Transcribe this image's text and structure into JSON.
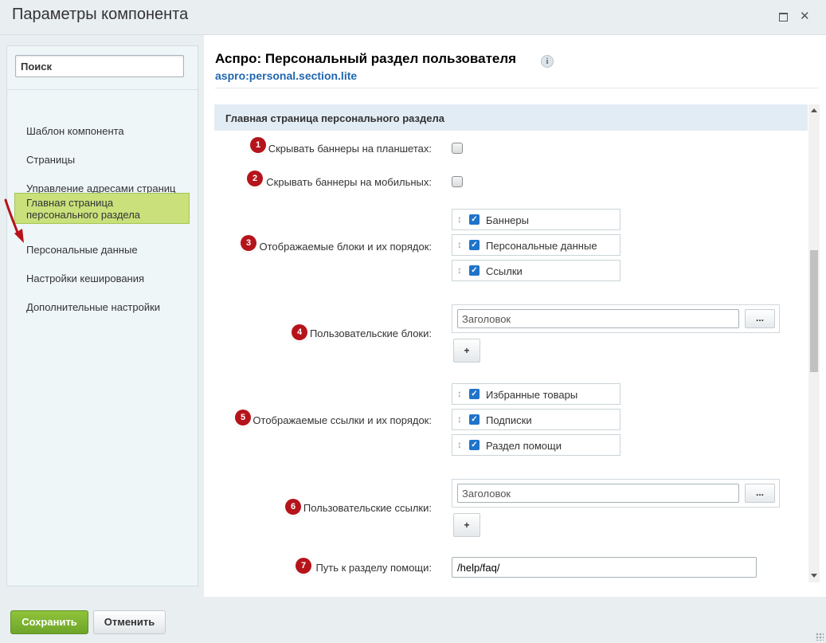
{
  "dialog": {
    "title": "Параметры компонента"
  },
  "sidebar": {
    "search_placeholder": "Поиск",
    "items": [
      {
        "label": "Шаблон компонента"
      },
      {
        "label": "Страницы"
      },
      {
        "label": "Управление адресами страниц"
      },
      {
        "label": "Главная страница персонального раздела",
        "line1": "Главная страница",
        "line2": "персонального раздела",
        "active": true
      },
      {
        "label": "Персональные данные"
      },
      {
        "label": "Настройки кеширования"
      },
      {
        "label": "Дополнительные настройки"
      }
    ]
  },
  "component": {
    "title": "Аспро: Персональный раздел пользователя",
    "code": "aspro:personal.section.lite",
    "info_icon": "i"
  },
  "section": {
    "title": "Главная страница персонального раздела",
    "params": [
      {
        "badge": "1",
        "label": "Скрывать баннеры на планшетах:",
        "checked": false
      },
      {
        "badge": "2",
        "label": "Скрывать баннеры на мобильных:",
        "checked": false
      },
      {
        "badge": "3",
        "label": "Отображаемые блоки и их порядок:",
        "items": [
          {
            "label": "Баннеры",
            "checked": true
          },
          {
            "label": "Персональные данные",
            "checked": true
          },
          {
            "label": "Ссылки",
            "checked": true
          }
        ]
      },
      {
        "badge": "4",
        "label": "Пользовательские блоки:",
        "placeholder": "Заголовок",
        "dots": "...",
        "add": "+"
      },
      {
        "badge": "5",
        "label": "Отображаемые ссылки и их порядок:",
        "items": [
          {
            "label": "Избранные товары",
            "checked": true
          },
          {
            "label": "Подписки",
            "checked": true
          },
          {
            "label": "Раздел помощи",
            "checked": true
          }
        ]
      },
      {
        "badge": "6",
        "label": "Пользовательские ссылки:",
        "placeholder": "Заголовок",
        "dots": "...",
        "add": "+"
      },
      {
        "badge": "7",
        "label": "Путь к разделу помощи:",
        "value": "/help/faq/"
      }
    ]
  },
  "footer": {
    "save_label": "Сохранить",
    "cancel_label": "Отменить"
  },
  "colors": {
    "badge": "#b5141b",
    "active_nav": "#c9e07b",
    "checkbox": "#1f74ca",
    "save": "#7ab332",
    "link": "#2067b0"
  }
}
